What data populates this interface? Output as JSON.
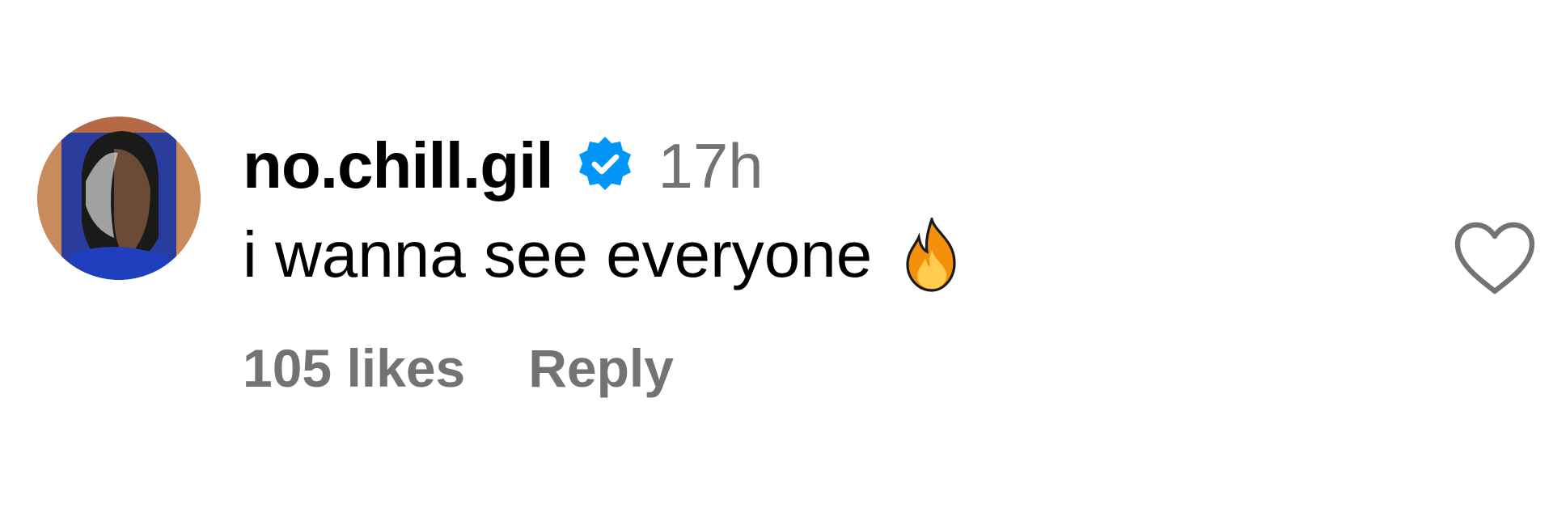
{
  "comment": {
    "username": "no.chill.gil",
    "verified": true,
    "timestamp": "17h",
    "text": "i wanna see everyone",
    "emoji": "fire-emoji",
    "likes": "105 likes",
    "reply_label": "Reply"
  },
  "icons": {
    "verified": "verified-badge-icon",
    "like": "heart-outline-icon"
  },
  "colors": {
    "verified_blue": "#0095F6",
    "secondary_text": "#737373",
    "primary_text": "#000000"
  }
}
